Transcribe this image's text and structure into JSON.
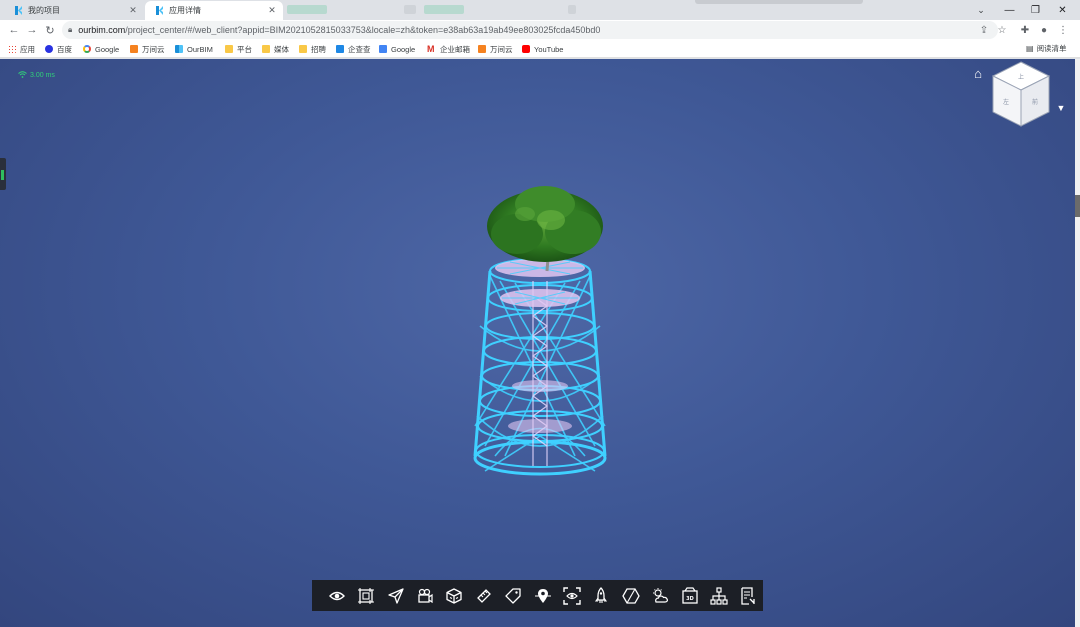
{
  "browser": {
    "tabs": [
      {
        "title": "我的项目",
        "active": false
      },
      {
        "title": "应用详情",
        "active": true
      }
    ],
    "url_host": "ourbim.com",
    "url_rest": "/project_center/#/web_client?appid=BIM2021052815033753&locale=zh&token=e38ab63a19ab49ee803025fcda450bd0",
    "bookmarks": [
      {
        "label": "应用",
        "icon": "apps-grid-icon"
      },
      {
        "label": "百度",
        "icon": "baidu-icon"
      },
      {
        "label": "Google",
        "icon": "google-icon"
      },
      {
        "label": "万间云",
        "icon": "wanjianyun-icon"
      },
      {
        "label": "OurBIM",
        "icon": "ourbim-icon"
      },
      {
        "label": "平台",
        "icon": "folder-icon"
      },
      {
        "label": "媒体",
        "icon": "folder-icon"
      },
      {
        "label": "招聘",
        "icon": "folder-icon"
      },
      {
        "label": "企查查",
        "icon": "qichacha-icon"
      },
      {
        "label": "Google",
        "icon": "google-translate-icon"
      },
      {
        "label": "企业邮箱",
        "icon": "mail-icon"
      },
      {
        "label": "万间云",
        "icon": "wanjianyun-icon"
      },
      {
        "label": "YouTube",
        "icon": "youtube-icon"
      }
    ],
    "reading_list": "阅读清单"
  },
  "viewer": {
    "latency": "3.00 ms",
    "background_color": "#3f5896",
    "model_color": "#3fd0ff"
  },
  "toolbar": {
    "tools": [
      {
        "name": "view-tool-eye"
      },
      {
        "name": "view-tool-section-box"
      },
      {
        "name": "view-tool-roam"
      },
      {
        "name": "view-tool-camera"
      },
      {
        "name": "view-tool-model-tree-box"
      },
      {
        "name": "view-tool-measure"
      },
      {
        "name": "view-tool-tag"
      },
      {
        "name": "view-tool-location"
      },
      {
        "name": "view-tool-focus"
      },
      {
        "name": "view-tool-explode"
      },
      {
        "name": "view-tool-material"
      },
      {
        "name": "view-tool-weather"
      },
      {
        "name": "view-tool-3d-view"
      },
      {
        "name": "view-tool-structure"
      },
      {
        "name": "view-tool-properties"
      }
    ]
  }
}
